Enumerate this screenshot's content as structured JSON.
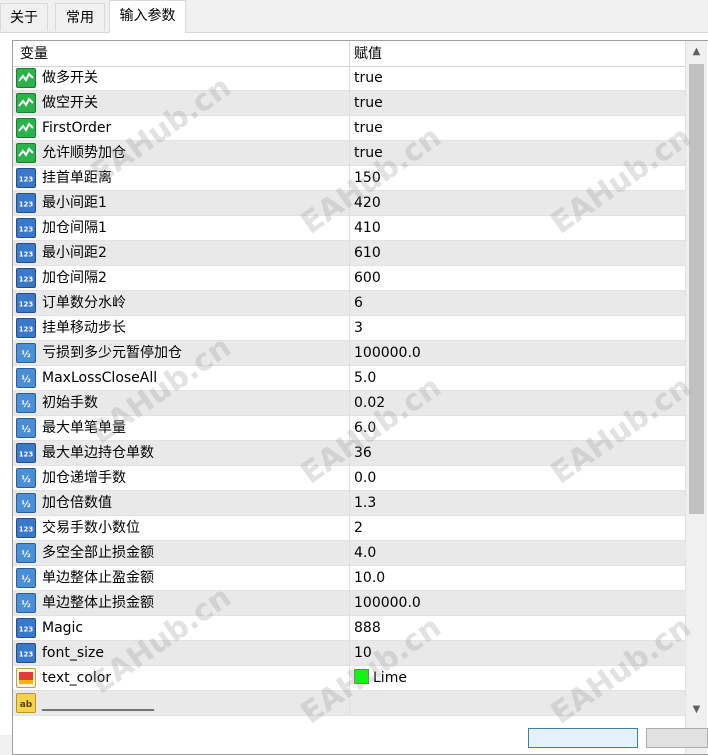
{
  "tabs": [
    {
      "label": "关于"
    },
    {
      "label": "常用"
    },
    {
      "label": "输入参数"
    }
  ],
  "table": {
    "col_variable": "变量",
    "col_value": "赋值",
    "rows": [
      {
        "type": "bool",
        "icon": "bool-icon",
        "name": "做多开关",
        "value": "true"
      },
      {
        "type": "bool",
        "icon": "bool-icon",
        "name": "做空开关",
        "value": "true"
      },
      {
        "type": "bool",
        "icon": "bool-icon",
        "name": "FirstOrder",
        "value": "true"
      },
      {
        "type": "bool",
        "icon": "bool-icon",
        "name": "允许顺势加仓",
        "value": "true"
      },
      {
        "type": "int",
        "icon": "integer-icon",
        "name": "挂首单距离",
        "value": "150"
      },
      {
        "type": "int",
        "icon": "integer-icon",
        "name": "最小间距1",
        "value": "420"
      },
      {
        "type": "int",
        "icon": "integer-icon",
        "name": "加仓间隔1",
        "value": "410"
      },
      {
        "type": "int",
        "icon": "integer-icon",
        "name": "最小间距2",
        "value": "610"
      },
      {
        "type": "int",
        "icon": "integer-icon",
        "name": "加仓间隔2",
        "value": "600"
      },
      {
        "type": "int",
        "icon": "integer-icon",
        "name": "订单数分水岭",
        "value": "6"
      },
      {
        "type": "int",
        "icon": "integer-icon",
        "name": "挂单移动步长",
        "value": "3"
      },
      {
        "type": "dbl",
        "icon": "double-icon",
        "name": "亏损到多少元暂停加仓",
        "value": "100000.0"
      },
      {
        "type": "dbl",
        "icon": "double-icon",
        "name": "MaxLossCloseAll",
        "value": "5.0"
      },
      {
        "type": "dbl",
        "icon": "double-icon",
        "name": "初始手数",
        "value": "0.02"
      },
      {
        "type": "dbl",
        "icon": "double-icon",
        "name": "最大单笔单量",
        "value": "6.0"
      },
      {
        "type": "int",
        "icon": "integer-icon",
        "name": "最大单边持仓单数",
        "value": "36"
      },
      {
        "type": "dbl",
        "icon": "double-icon",
        "name": "加仓递增手数",
        "value": "0.0"
      },
      {
        "type": "dbl",
        "icon": "double-icon",
        "name": "加仓倍数值",
        "value": "1.3"
      },
      {
        "type": "int",
        "icon": "integer-icon",
        "name": "交易手数小数位",
        "value": "2"
      },
      {
        "type": "dbl",
        "icon": "double-icon",
        "name": "多空全部止损金额",
        "value": "4.0"
      },
      {
        "type": "dbl",
        "icon": "double-icon",
        "name": "单边整体止盈金额",
        "value": "10.0"
      },
      {
        "type": "dbl",
        "icon": "double-icon",
        "name": "单边整体止损金额",
        "value": "100000.0"
      },
      {
        "type": "int",
        "icon": "integer-icon",
        "name": "Magic",
        "value": "888"
      },
      {
        "type": "int",
        "icon": "integer-icon",
        "name": "font_size",
        "value": "10"
      },
      {
        "type": "color",
        "icon": "color-icon",
        "name": "text_color",
        "value": "Lime",
        "swatch": "#00ff00"
      },
      {
        "type": "str",
        "icon": "string-icon",
        "name": "________________",
        "value": ""
      }
    ]
  },
  "watermark_text": "EAHub.cn",
  "colors": {
    "swatch_lime": "#00ff00",
    "row_alt": "#e9e9e9"
  }
}
